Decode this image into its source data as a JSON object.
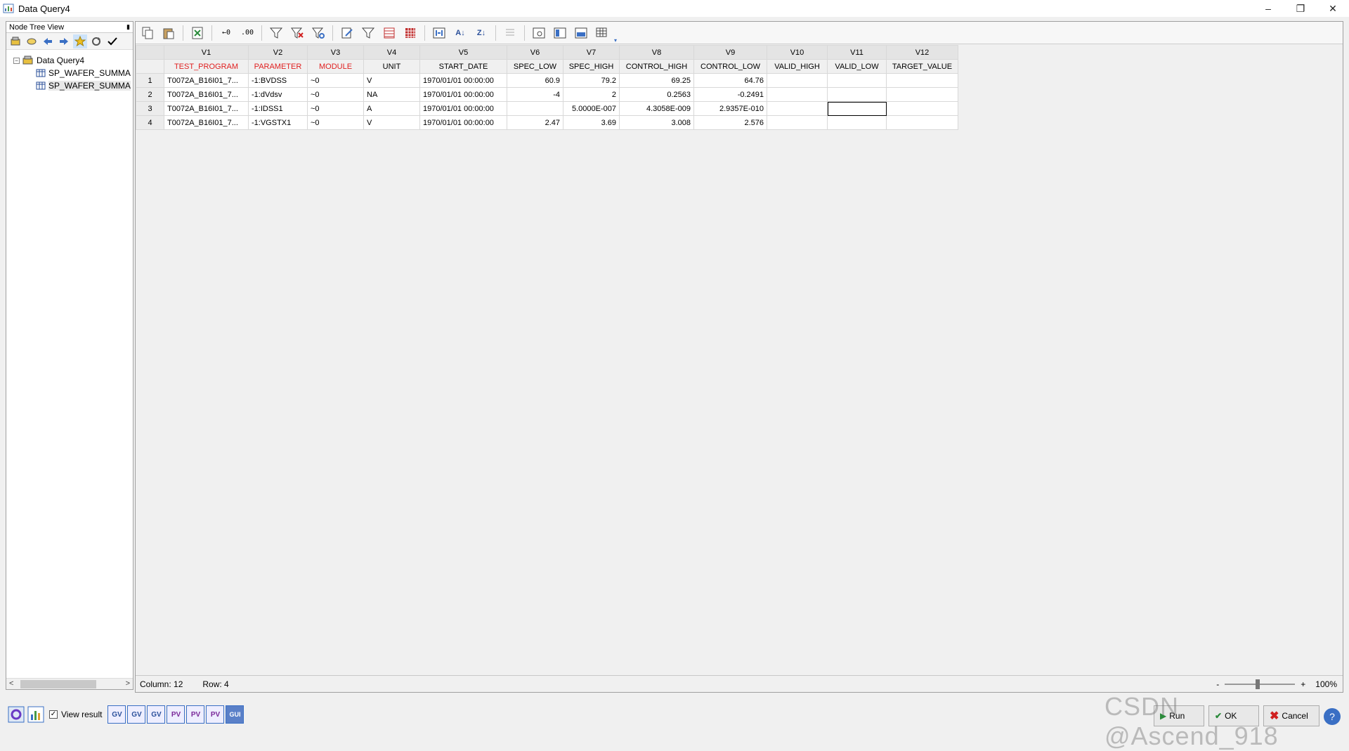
{
  "window": {
    "title": "Data Query4",
    "controls": [
      "–",
      "❐",
      "✕"
    ]
  },
  "left_panel": {
    "header": "Node Tree View",
    "pin": "📌",
    "tree": {
      "root": "Data Query4",
      "children": [
        "SP_WAFER_SUMMA",
        "SP_WAFER_SUMMA"
      ]
    }
  },
  "grid": {
    "columns": [
      "V1",
      "V2",
      "V3",
      "V4",
      "V5",
      "V6",
      "V7",
      "V8",
      "V9",
      "V10",
      "V11",
      "V12"
    ],
    "names": [
      "TEST_PROGRAM",
      "PARAMETER",
      "MODULE",
      "UNIT",
      "START_DATE",
      "SPEC_LOW",
      "SPEC_HIGH",
      "CONTROL_HIGH",
      "CONTROL_LOW",
      "VALID_HIGH",
      "VALID_LOW",
      "TARGET_VALUE"
    ],
    "rows": [
      [
        "1",
        "T0072A_B16I01_7...",
        "-1:BVDSS",
        "~0",
        "V",
        "1970/01/01 00:00:00",
        "60.9",
        "79.2",
        "69.25",
        "64.76",
        "",
        "",
        ""
      ],
      [
        "2",
        "T0072A_B16I01_7...",
        "-1:dVdsv",
        "~0",
        "NA",
        "1970/01/01 00:00:00",
        "-4",
        "2",
        "0.2563",
        "-0.2491",
        "",
        "",
        ""
      ],
      [
        "3",
        "T0072A_B16I01_7...",
        "-1:IDSS1",
        "~0",
        "A",
        "1970/01/01 00:00:00",
        "",
        "5.0000E-007",
        "4.3058E-009",
        "2.9357E-010",
        "",
        "",
        ""
      ],
      [
        "4",
        "T0072A_B16I01_7...",
        "-1:VGSTX1",
        "~0",
        "V",
        "1970/01/01 00:00:00",
        "2.47",
        "3.69",
        "3.008",
        "2.576",
        "",
        "",
        ""
      ]
    ]
  },
  "status": {
    "column": "Column: 12",
    "row": "Row: 4",
    "zoom_minus": "-",
    "zoom_plus": "+",
    "zoom": "100%"
  },
  "bottom": {
    "view_result": "View result",
    "buttons": {
      "gv1": "GV",
      "gv2": "GV",
      "gv3": "GV",
      "pv1": "PV",
      "pv2": "PV",
      "pv3": "PV",
      "gui": "GUI"
    },
    "run": "Run",
    "ok": "OK",
    "cancel": "Cancel"
  },
  "watermark": "CSDN @Ascend_918",
  "colors": {
    "selected_header": "#e02020",
    "accent": "#3a6fc4"
  }
}
